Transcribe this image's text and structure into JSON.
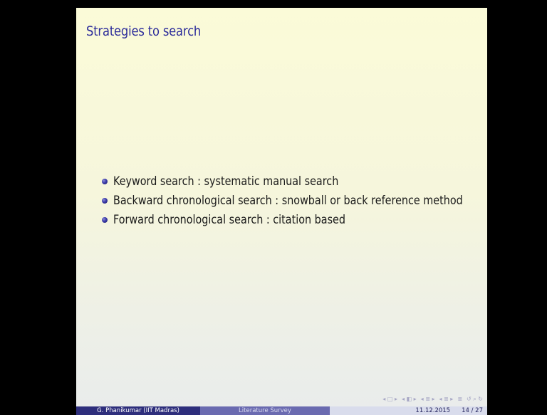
{
  "slide": {
    "title": "Strategies to search",
    "bullets": [
      {
        "text": "Keyword search : systematic manual search"
      },
      {
        "text": "Backward chronological search : snowball or back reference method"
      },
      {
        "text": "Forward chronological search : citation based"
      }
    ]
  },
  "navigation": {
    "symbols": [
      "◂ □ ▸",
      "◂ ◧ ▸",
      "◂ ≣ ▸",
      "◂ ≣ ▸",
      "≣",
      "↺ ⌕ ↻"
    ]
  },
  "footer": {
    "author": "G. Phanikumar (IIT Madras)",
    "presentation_title": "Literature Survey",
    "date": "11.12.2015",
    "page": "14 / 27"
  },
  "colors": {
    "title": "#2b2b9a",
    "footer_dark": "#2e2e7c",
    "footer_mid": "#6a6ab0",
    "footer_light": "#d9dcec"
  }
}
